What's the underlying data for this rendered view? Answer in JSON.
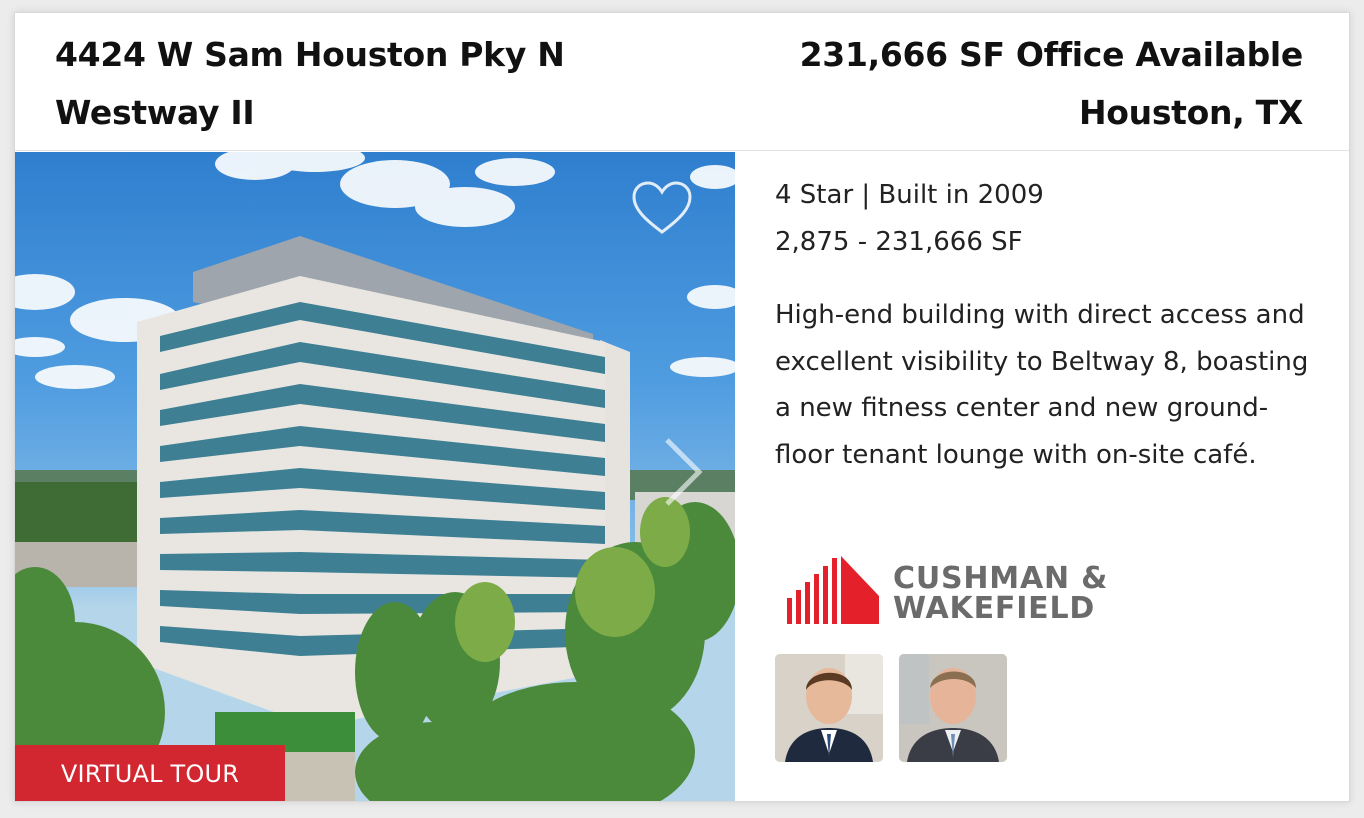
{
  "listing": {
    "address": "4424 W Sam Houston Pky N",
    "building_name": "Westway II",
    "availability": "231,666 SF Office Available",
    "location": "Houston, TX",
    "rating_built": "4 Star | Built in 2009",
    "size_range": "2,875 - 231,666 SF",
    "description": "High-end building with direct access and excellent visibility to Beltway 8, boasting a new fitness center and new ground-floor tenant lounge with on-site café.",
    "virtual_tour_label": "VIRTUAL TOUR"
  },
  "broker": {
    "logo_line1": "CUSHMAN &",
    "logo_line2": "WAKEFIELD",
    "logo_color": "#e4202a"
  },
  "icons": {
    "favorite": "heart-icon",
    "next": "chevron-right-icon"
  },
  "colors": {
    "accent": "#d22630",
    "text": "#1a1a1a"
  }
}
